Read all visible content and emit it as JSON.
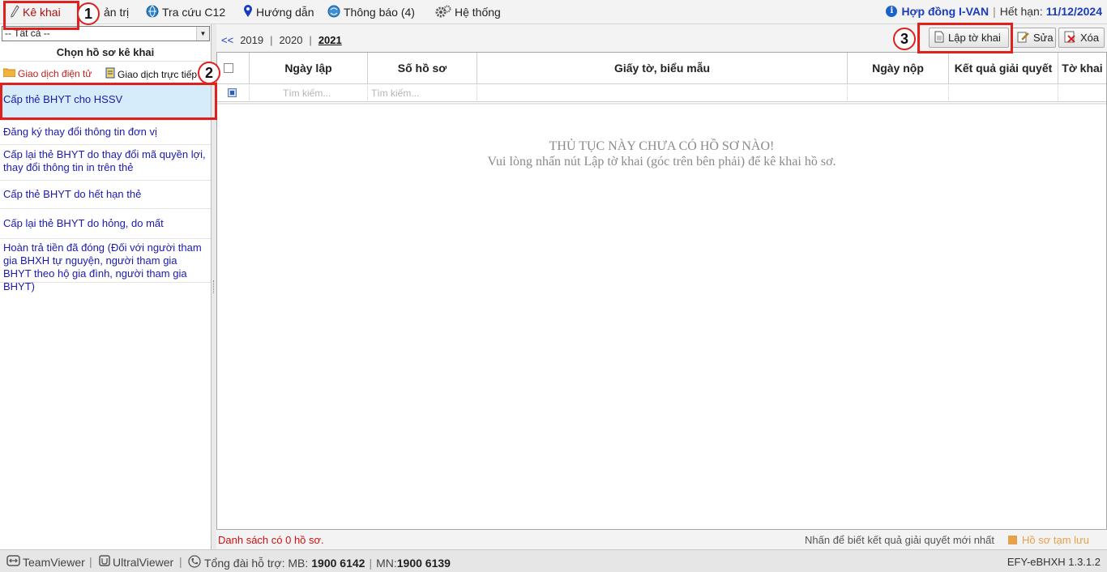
{
  "menu": {
    "items": [
      {
        "label": "Kê khai",
        "icon": "pen-icon"
      },
      {
        "label": "ản trị",
        "icon": "admin-icon"
      },
      {
        "label": "Tra cứu C12",
        "icon": "globe-icon"
      },
      {
        "label": "Hướng dẫn",
        "icon": "pin-icon"
      },
      {
        "label": "Thông báo (4)",
        "icon": "bell-globe-icon"
      },
      {
        "label": "Hệ thống",
        "icon": "gears-icon"
      }
    ],
    "contract_label": "Hợp đồng I-VAN",
    "expiry_label": "Hết hạn:",
    "expiry_date": "11/12/2024"
  },
  "left": {
    "filter_value": "-- Tất cả --",
    "heading": "Chọn hồ sơ kê khai",
    "tabs": [
      {
        "label": "Giao dịch điện tử",
        "icon": "folder-icon"
      },
      {
        "label": "Giao dịch trực tiếp",
        "icon": "document-icon"
      }
    ],
    "procedures": [
      {
        "label": "Cấp thẻ BHYT cho HSSV"
      },
      {
        "label": "Đăng ký thay đổi thông tin đơn vị"
      },
      {
        "label": "Cấp lại thẻ BHYT do thay đổi mã quyền lợi, thay đổi thông tin in trên thẻ"
      },
      {
        "label": "Cấp thẻ BHYT do hết hạn thẻ"
      },
      {
        "label": "Cấp lại thẻ BHYT do hỏng, do mất"
      },
      {
        "label": "Hoàn trả tiền đã đóng (Đối với người tham gia BHXH tự nguyện, người tham gia BHYT theo hộ gia đình, người tham gia BHYT)"
      }
    ]
  },
  "years": {
    "nav": "<<",
    "list": [
      "2019",
      "2020",
      "2021"
    ],
    "current": "2021"
  },
  "toolbar": {
    "create_label": "Lập tờ khai",
    "edit_label": "Sửa",
    "delete_label": "Xóa"
  },
  "grid": {
    "columns": [
      "Ngày lập",
      "Số hồ sơ",
      "Giấy tờ, biểu mẫu",
      "Ngày nộp",
      "Kết quả giải quyết",
      "Tờ khai"
    ],
    "search_placeholder": "Tìm kiếm...",
    "empty_title": "THỦ TỤC NÀY CHƯA CÓ HỒ SƠ NÀO!",
    "empty_hint": "Vui lòng nhấn nút Lập tờ khai (góc trên bên phải) để kê khai hồ sơ."
  },
  "status": {
    "count_text": "Danh sách có 0 hồ sơ.",
    "hint_text": "Nhấn để biết kết quả giải quyết mới nhất",
    "draft_label": "Hồ sơ tạm lưu"
  },
  "footer": {
    "teamviewer": "TeamViewer",
    "ultraviewer": "UltralViewer",
    "hotline_label": "Tổng đài hỗ trợ: MB:",
    "hotline_mb": "1900 6142",
    "hotline_mn_label": "MN:",
    "hotline_mn": "1900 6139",
    "version": "EFY-eBHXH 1.3.1.2"
  },
  "annotations": [
    "1",
    "2",
    "3"
  ],
  "colors": {
    "accent_red": "#e0201c",
    "link_blue": "#1a1ab0",
    "selected_bg": "#d7ecfa"
  }
}
